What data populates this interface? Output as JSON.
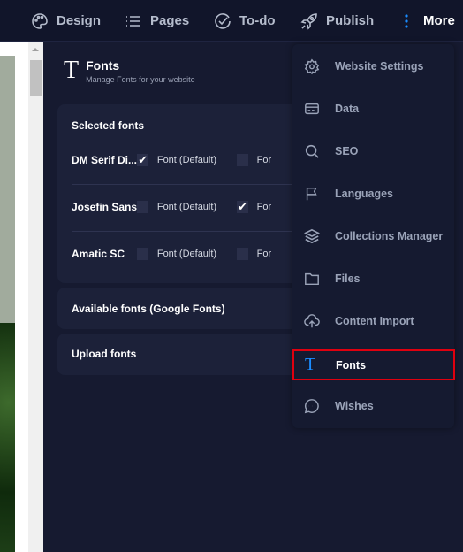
{
  "topnav": [
    {
      "label": "Design",
      "icon": "palette-icon"
    },
    {
      "label": "Pages",
      "icon": "list-icon"
    },
    {
      "label": "To-do",
      "icon": "check-circle-icon"
    },
    {
      "label": "Publish",
      "icon": "rocket-icon"
    },
    {
      "label": "More",
      "icon": "more-vertical-icon"
    }
  ],
  "panel": {
    "title": "Fonts",
    "subtitle": "Manage Fonts for your website",
    "selected_heading": "Selected fonts",
    "fonts": [
      {
        "name": "DM Serif Di...",
        "col1": "Font (Default)",
        "col1_checked": true,
        "col2": "For",
        "col2_checked": false
      },
      {
        "name": "Josefin Sans",
        "col1": "Font (Default)",
        "col1_checked": false,
        "col2": "For",
        "col2_checked": true
      },
      {
        "name": "Amatic SC",
        "col1": "Font (Default)",
        "col1_checked": false,
        "col2": "For",
        "col2_checked": false
      }
    ],
    "available_heading": "Available fonts (Google Fonts)",
    "upload_heading": "Upload fonts"
  },
  "menu": {
    "items": [
      {
        "label": "Website Settings",
        "icon": "gear-icon"
      },
      {
        "label": "Data",
        "icon": "card-icon"
      },
      {
        "label": "SEO",
        "icon": "search-icon"
      },
      {
        "label": "Languages",
        "icon": "flag-icon"
      },
      {
        "label": "Collections Manager",
        "icon": "layers-icon"
      },
      {
        "label": "Files",
        "icon": "folder-icon"
      },
      {
        "label": "Content Import",
        "icon": "cloud-upload-icon"
      },
      {
        "label": "Fonts",
        "icon": "font-icon",
        "active": true
      },
      {
        "label": "Wishes",
        "icon": "chat-icon"
      }
    ]
  },
  "colors": {
    "accent": "#1a8cff",
    "highlight": "#e0000f"
  }
}
